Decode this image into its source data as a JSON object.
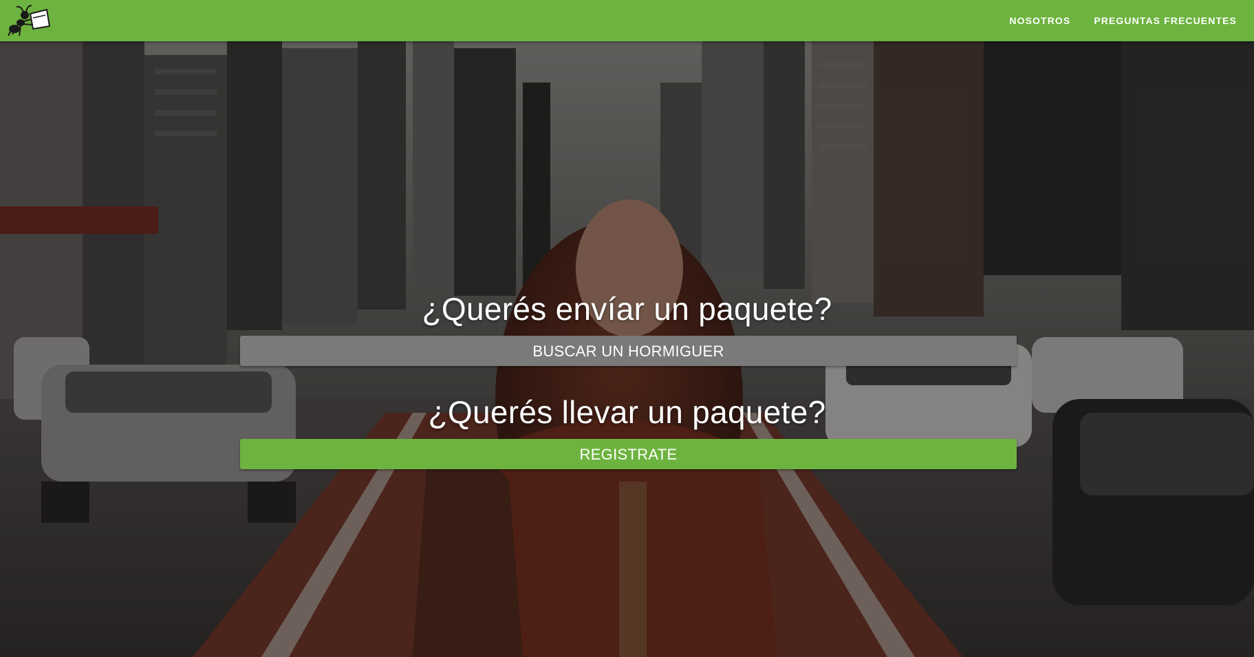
{
  "navbar": {
    "logo_icon": "ant-carrying-package-icon",
    "links": [
      {
        "label": "NOSOTROS"
      },
      {
        "label": "PREGUNTAS FRECUENTES"
      }
    ]
  },
  "hero": {
    "send": {
      "question": "¿Querés envíar un paquete?",
      "button_label": "BUSCAR UN HORMIGUER"
    },
    "carry": {
      "question": "¿Querés llevar un paquete?",
      "button_label": "REGISTRATE"
    }
  },
  "colors": {
    "brand_green": "#6db33f",
    "secondary_gray": "#7a7a7a",
    "text_white": "#ffffff"
  }
}
